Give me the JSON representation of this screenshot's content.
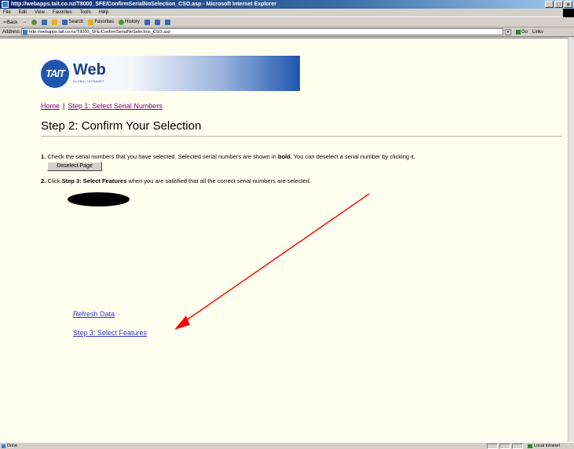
{
  "window": {
    "title": "http://webapps.tait.co.nz/T8000_SFE/ConfirmSerialNoSelection_CSO.asp - Microsoft Internet Explorer",
    "min": "_",
    "max": "□",
    "close": "×"
  },
  "menu": [
    "File",
    "Edit",
    "View",
    "Favorites",
    "Tools",
    "Help"
  ],
  "toolbar": {
    "back": "⇦Back",
    "forward": "→",
    "search": "Search",
    "favorites": "Favorites",
    "history": "History"
  },
  "address": {
    "label": "Address",
    "url": "http://webapps.tait.co.nz/T8000_SFE/ConfirmSerialNoSelection_CSO.asp",
    "go": "Go",
    "links": "Links"
  },
  "logo": {
    "mark": "TAIT",
    "name": "Web",
    "tagline": "GLOBAL INTRANET"
  },
  "breadcrumb": {
    "home": "Home",
    "separator": "|",
    "step1": "Step 1: Select Serial Numbers"
  },
  "page_title": "Step 2: Confirm Your Selection",
  "instructions": {
    "step1_num": "1.",
    "step1_text_a": "Check the serial numbers that you have selected. Selected serial numbers are shown in",
    "step1_bold": "bold.",
    "step1_text_b": "You can deselect a serial number by clicking it.",
    "deselect_button": "Deselect Page",
    "step2_num": "2.",
    "step2_text_a": "Click",
    "step2_bold": "Step 3: Select Features",
    "step2_text_b": "when you are satisfied that all the correct serial numbers are selected."
  },
  "links": {
    "refresh": "Refresh Data",
    "step3": "Step 3: Select Features"
  },
  "status": {
    "text": "Done",
    "zone": "Local intranet"
  },
  "colors": {
    "annotation_arrow": "#ff0000",
    "visited_link": "#800080",
    "link": "#3333cc",
    "page_background": "#fffff0"
  }
}
